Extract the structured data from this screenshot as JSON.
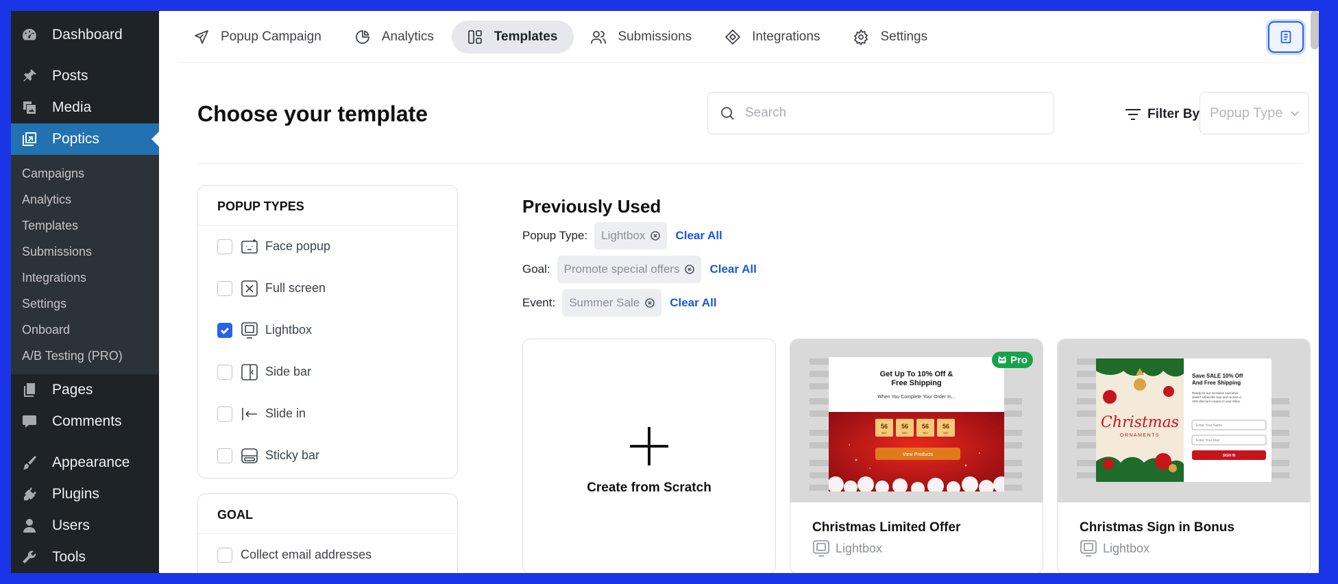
{
  "sidebar": {
    "items": [
      {
        "label": "Dashboard",
        "icon": "dashboard-icon"
      },
      {
        "label": "Posts",
        "icon": "pin-icon"
      },
      {
        "label": "Media",
        "icon": "media-icon"
      },
      {
        "label": "Poptics",
        "icon": "poptics-icon"
      }
    ],
    "sub_items": [
      "Campaigns",
      "Analytics",
      "Templates",
      "Submissions",
      "Integrations",
      "Settings",
      "Onboard",
      "A/B Testing (PRO)"
    ],
    "items_after": [
      {
        "label": "Pages",
        "icon": "pages-icon"
      },
      {
        "label": "Comments",
        "icon": "comments-icon"
      }
    ],
    "items_bottom": [
      {
        "label": "Appearance",
        "icon": "brush-icon"
      },
      {
        "label": "Plugins",
        "icon": "plug-icon"
      },
      {
        "label": "Users",
        "icon": "user-icon"
      },
      {
        "label": "Tools",
        "icon": "wrench-icon"
      }
    ]
  },
  "tabs": [
    {
      "label": "Popup Campaign",
      "icon": "paper-plane-icon"
    },
    {
      "label": "Analytics",
      "icon": "pie-chart-icon"
    },
    {
      "label": "Templates",
      "icon": "layout-icon",
      "active": true
    },
    {
      "label": "Submissions",
      "icon": "users-icon"
    },
    {
      "label": "Integrations",
      "icon": "diamond-link-icon"
    },
    {
      "label": "Settings",
      "icon": "gear-icon"
    }
  ],
  "page": {
    "title": "Choose your template",
    "search_placeholder": "Search",
    "filter_by": "Filter By",
    "popup_type_placeholder": "Popup Type"
  },
  "filters": {
    "popup_types_title": "POPUP TYPES",
    "popup_types": [
      {
        "label": "Face popup",
        "checked": false
      },
      {
        "label": "Full screen",
        "checked": false
      },
      {
        "label": "Lightbox",
        "checked": true
      },
      {
        "label": "Side bar",
        "checked": false
      },
      {
        "label": "Slide in",
        "checked": false
      },
      {
        "label": "Sticky bar",
        "checked": false
      }
    ],
    "goal_title": "GOAL",
    "goals": [
      {
        "label": "Collect email addresses",
        "checked": false
      }
    ]
  },
  "previously_used": {
    "title": "Previously Used",
    "rows": [
      {
        "label": "Popup Type:",
        "chip": "Lightbox",
        "clear": "Clear All"
      },
      {
        "label": "Goal:",
        "chip": "Promote special offers",
        "clear": "Clear All"
      },
      {
        "label": "Event:",
        "chip": "Summer Sale",
        "clear": "Clear All"
      }
    ]
  },
  "cards": {
    "scratch_label": "Create from Scratch",
    "templates": [
      {
        "title": "Christmas Limited Offer",
        "type": "Lightbox",
        "pro": "Pro",
        "preview": {
          "headline": "Get Up To 10% Off & Free Shipping",
          "sub": "When You Complete Your Order In...",
          "countdown": [
            "56",
            "56",
            "56",
            "56"
          ],
          "countdown_unit": "SEC",
          "button": "View Products"
        }
      },
      {
        "title": "Christmas Sign in Bonus",
        "type": "Lightbox",
        "preview": {
          "art_title": "Christmas",
          "art_sub": "ORNAMENTS",
          "headline": "Save SALE 10% Off And Free Shipping",
          "body": "Ready for our exclusive executive deals? subscribe now and receive a 10% discount coupon in your inbox.",
          "name_placeholder": "Enter Your Name",
          "mail_placeholder": "Enter Your Mail",
          "button": "SIGN IN"
        }
      }
    ]
  },
  "colors": {
    "wp_sidebar": "#1d2327",
    "wp_active": "#2271b1",
    "accent": "#2563eb",
    "link": "#1a56db",
    "pro": "#16a34a",
    "xmas_red": "#c8141c"
  }
}
